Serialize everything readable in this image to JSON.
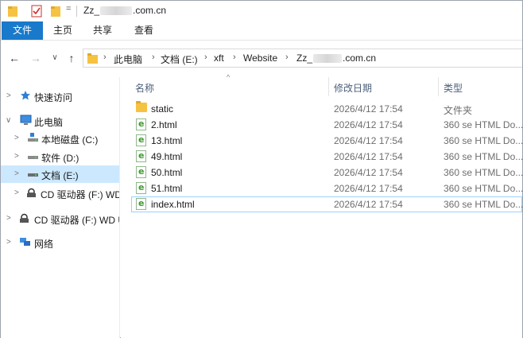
{
  "window": {
    "title_prefix": "Zz_",
    "title_suffix": ".com.cn",
    "title_down_arrow": "="
  },
  "ribbon": {
    "tabs": [
      "文件",
      "主页",
      "共享",
      "查看"
    ]
  },
  "nav": {
    "back": "←",
    "forward": "→",
    "dropdown": "∨",
    "up": "↑"
  },
  "address": {
    "chevron": "›",
    "crumbs": [
      "此电脑",
      "文档 (E:)",
      "xft",
      "Website"
    ],
    "last_prefix": "Zz_",
    "last_suffix": ".com.cn"
  },
  "sidebar": {
    "items": [
      {
        "label": "快速访问",
        "icon": "star-icon"
      },
      {
        "label": "此电脑",
        "icon": "computer-icon"
      },
      {
        "label": "本地磁盘 (C:)",
        "icon": "drive-c-icon"
      },
      {
        "label": "软件 (D:)",
        "icon": "drive-icon"
      },
      {
        "label": "文档 (E:)",
        "icon": "drive-icon"
      },
      {
        "label": "CD 驱动器 (F:) WD",
        "icon": "cd-drive-icon"
      },
      {
        "label": "CD 驱动器 (F:) WD U",
        "icon": "cd-drive-icon"
      },
      {
        "label": "网络",
        "icon": "network-icon"
      }
    ]
  },
  "columns": {
    "name": "名称",
    "date": "修改日期",
    "type": "类型",
    "sort_arrow": "^"
  },
  "files": [
    {
      "name": "static",
      "date": "2026/4/12 17:54",
      "type": "文件夹",
      "kind": "folder"
    },
    {
      "name": "2.html",
      "date": "2026/4/12 17:54",
      "type": "360 se HTML Do...",
      "kind": "html"
    },
    {
      "name": "13.html",
      "date": "2026/4/12 17:54",
      "type": "360 se HTML Do...",
      "kind": "html"
    },
    {
      "name": "49.html",
      "date": "2026/4/12 17:54",
      "type": "360 se HTML Do...",
      "kind": "html"
    },
    {
      "name": "50.html",
      "date": "2026/4/12 17:54",
      "type": "360 se HTML Do...",
      "kind": "html"
    },
    {
      "name": "51.html",
      "date": "2026/4/12 17:54",
      "type": "360 se HTML Do...",
      "kind": "html"
    },
    {
      "name": "index.html",
      "date": "2026/4/12 17:54",
      "type": "360 se HTML Do...",
      "kind": "html"
    }
  ],
  "colors": {
    "accent": "#1979ca",
    "selection": "#cce8ff",
    "focus_border": "#99d1ff",
    "folder": "#f5c242"
  }
}
